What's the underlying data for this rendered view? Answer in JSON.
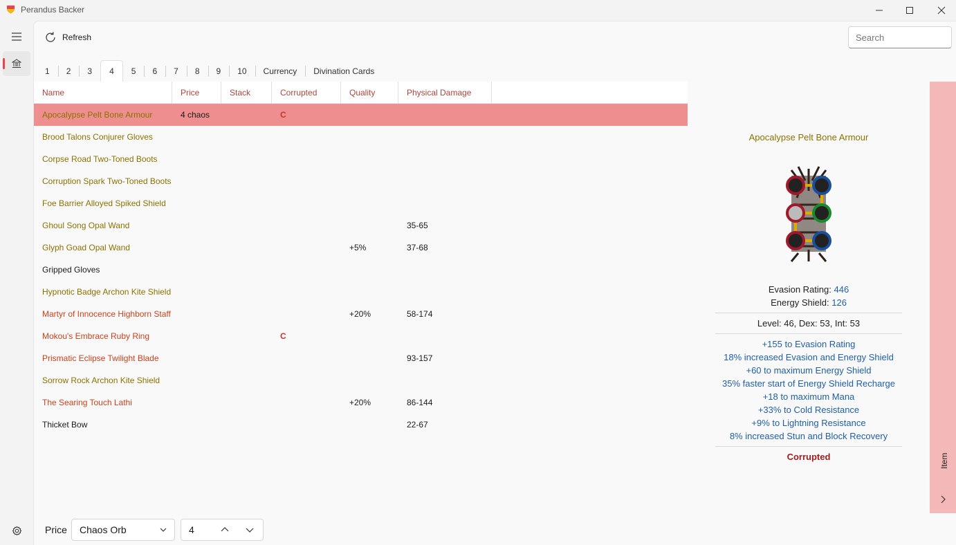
{
  "window": {
    "title": "Perandus Backer"
  },
  "toolbar": {
    "refresh_label": "Refresh",
    "search_placeholder": "Search"
  },
  "tabs": [
    "1",
    "2",
    "3",
    "4",
    "5",
    "6",
    "7",
    "8",
    "9",
    "10",
    "Currency",
    "Divination Cards"
  ],
  "selected_tab": "4",
  "table": {
    "columns": [
      "Name",
      "Price",
      "Stack",
      "Corrupted",
      "Quality",
      "Physical Damage"
    ],
    "rows": [
      {
        "name": "Apocalypse Pelt Bone Armour",
        "price": "4 chaos",
        "stack": "",
        "corrupted": "C",
        "quality": "",
        "phys": "",
        "rarity": "rare",
        "selected": true
      },
      {
        "name": "Brood Talons Conjurer Gloves",
        "price": "",
        "stack": "",
        "corrupted": "",
        "quality": "",
        "phys": "",
        "rarity": "rare"
      },
      {
        "name": "Corpse Road Two-Toned Boots",
        "price": "",
        "stack": "",
        "corrupted": "",
        "quality": "",
        "phys": "",
        "rarity": "rare"
      },
      {
        "name": "Corruption Spark Two-Toned Boots",
        "price": "",
        "stack": "",
        "corrupted": "",
        "quality": "",
        "phys": "",
        "rarity": "rare"
      },
      {
        "name": "Foe Barrier Alloyed Spiked Shield",
        "price": "",
        "stack": "",
        "corrupted": "",
        "quality": "",
        "phys": "",
        "rarity": "rare"
      },
      {
        "name": "Ghoul Song Opal Wand",
        "price": "",
        "stack": "",
        "corrupted": "",
        "quality": "",
        "phys": "35-65",
        "rarity": "rare"
      },
      {
        "name": "Glyph Goad Opal Wand",
        "price": "",
        "stack": "",
        "corrupted": "",
        "quality": "+5%",
        "phys": "37-68",
        "rarity": "rare"
      },
      {
        "name": "Gripped Gloves",
        "price": "",
        "stack": "",
        "corrupted": "",
        "quality": "",
        "phys": "",
        "rarity": "normal"
      },
      {
        "name": "Hypnotic Badge Archon Kite Shield",
        "price": "",
        "stack": "",
        "corrupted": "",
        "quality": "",
        "phys": "",
        "rarity": "rare"
      },
      {
        "name": "Martyr of Innocence Highborn Staff",
        "price": "",
        "stack": "",
        "corrupted": "",
        "quality": "+20%",
        "phys": "58-174",
        "rarity": "unique"
      },
      {
        "name": "Mokou's Embrace Ruby Ring",
        "price": "",
        "stack": "",
        "corrupted": "C",
        "quality": "",
        "phys": "",
        "rarity": "unique"
      },
      {
        "name": "Prismatic Eclipse Twilight Blade",
        "price": "",
        "stack": "",
        "corrupted": "",
        "quality": "",
        "phys": "93-157",
        "rarity": "unique"
      },
      {
        "name": "Sorrow Rock Archon Kite Shield",
        "price": "",
        "stack": "",
        "corrupted": "",
        "quality": "",
        "phys": "",
        "rarity": "rare"
      },
      {
        "name": "The Searing Touch Lathi",
        "price": "",
        "stack": "",
        "corrupted": "",
        "quality": "+20%",
        "phys": "86-144",
        "rarity": "unique"
      },
      {
        "name": "Thicket Bow",
        "price": "",
        "stack": "",
        "corrupted": "",
        "quality": "",
        "phys": "22-67",
        "rarity": "normal"
      }
    ]
  },
  "rarity_colors": {
    "rare": "#8a7200",
    "unique": "#c8411b",
    "normal": "#1a1a1a"
  },
  "detail": {
    "name": "Apocalypse Pelt Bone Armour",
    "evasion_label": "Evasion Rating: ",
    "evasion_value": "446",
    "es_label": "Energy Shield: ",
    "es_value": "126",
    "requirements": "Level: 46, Dex: 53, Int: 53",
    "mods": [
      "+155 to Evasion Rating",
      "18% increased Evasion and Energy Shield",
      "+60 to maximum Energy Shield",
      "35% faster start of Energy Shield Recharge",
      "+18 to maximum Mana",
      "+33% to Cold Resistance",
      "+9% to Lightning Resistance",
      "8% increased Stun and Block Recovery"
    ],
    "corrupted_label": "Corrupted"
  },
  "side_panel": {
    "label": "Item"
  },
  "bottom": {
    "price_label": "Price",
    "currency": "Chaos Orb",
    "amount": "4"
  },
  "icons": [
    "app-logo-icon",
    "minimize-icon",
    "maximize-icon",
    "close-icon",
    "hamburger-icon",
    "bank-icon",
    "settings-gear-icon",
    "refresh-icon",
    "chevron-down-icon",
    "chevron-up-icon",
    "chevron-right-icon"
  ],
  "colors": {
    "selected_row": "#ee8e8e",
    "side_panel": "#f4b8b8",
    "header_text": "#a8473f",
    "mod_text": "#1f5fa8",
    "corrupted_text": "#a01d1d"
  }
}
